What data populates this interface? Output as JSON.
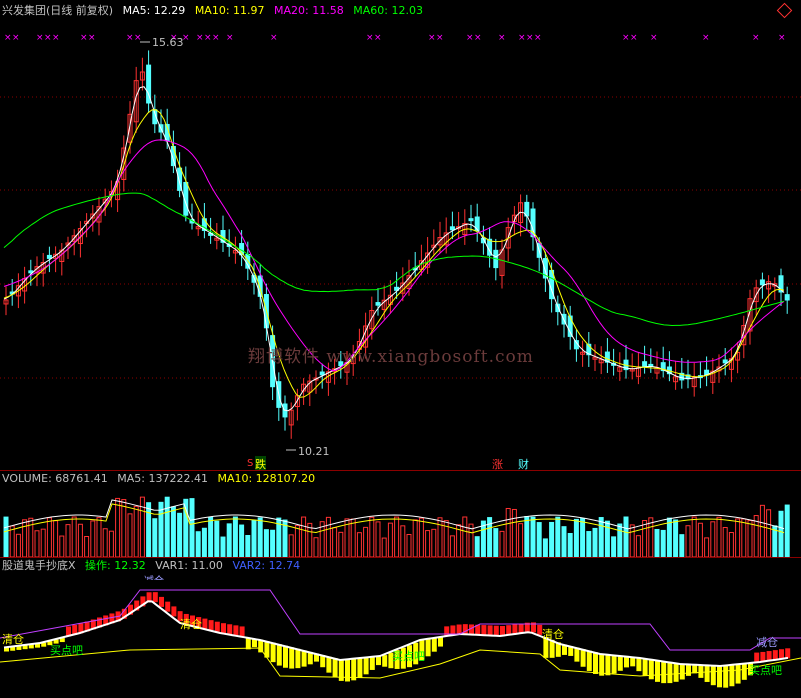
{
  "main": {
    "title": "兴发集团(日线 前复权)",
    "ma5": "MA5: 12.29",
    "ma10": "MA10: 11.97",
    "ma20": "MA20: 11.58",
    "ma60": "MA60: 12.03",
    "high_label": "15.63",
    "low_label": "10.21",
    "event_drop": "跌",
    "event_s": "S",
    "event_rise": "涨",
    "event_fin": "财",
    "colors": {
      "up": "#ff3232",
      "down": "#54ffff",
      "ma5": "#ffffff",
      "ma10": "#ffff00",
      "ma20": "#ff00ff",
      "ma60": "#00ff00"
    }
  },
  "volume": {
    "label": "VOLUME: 68761.41",
    "ma5": "MA5: 137222.41",
    "ma10": "MA10: 128107.20"
  },
  "indicator": {
    "name": "股道鬼手抄底X",
    "op": "操作: 12.32",
    "var1": "VAR1: 11.00",
    "var2": "VAR2: 12.74",
    "tags": {
      "jiancang_top": "减仓",
      "qingcang1": "清仓",
      "qingcang2": "清仓",
      "qingcang3": "清仓",
      "jiancang2": "减仓",
      "buy1": "买点吧",
      "buy2": "买点吧",
      "buy3": "买点吧"
    }
  },
  "watermark": "翔博软件 www.xiangbosoft.com"
}
